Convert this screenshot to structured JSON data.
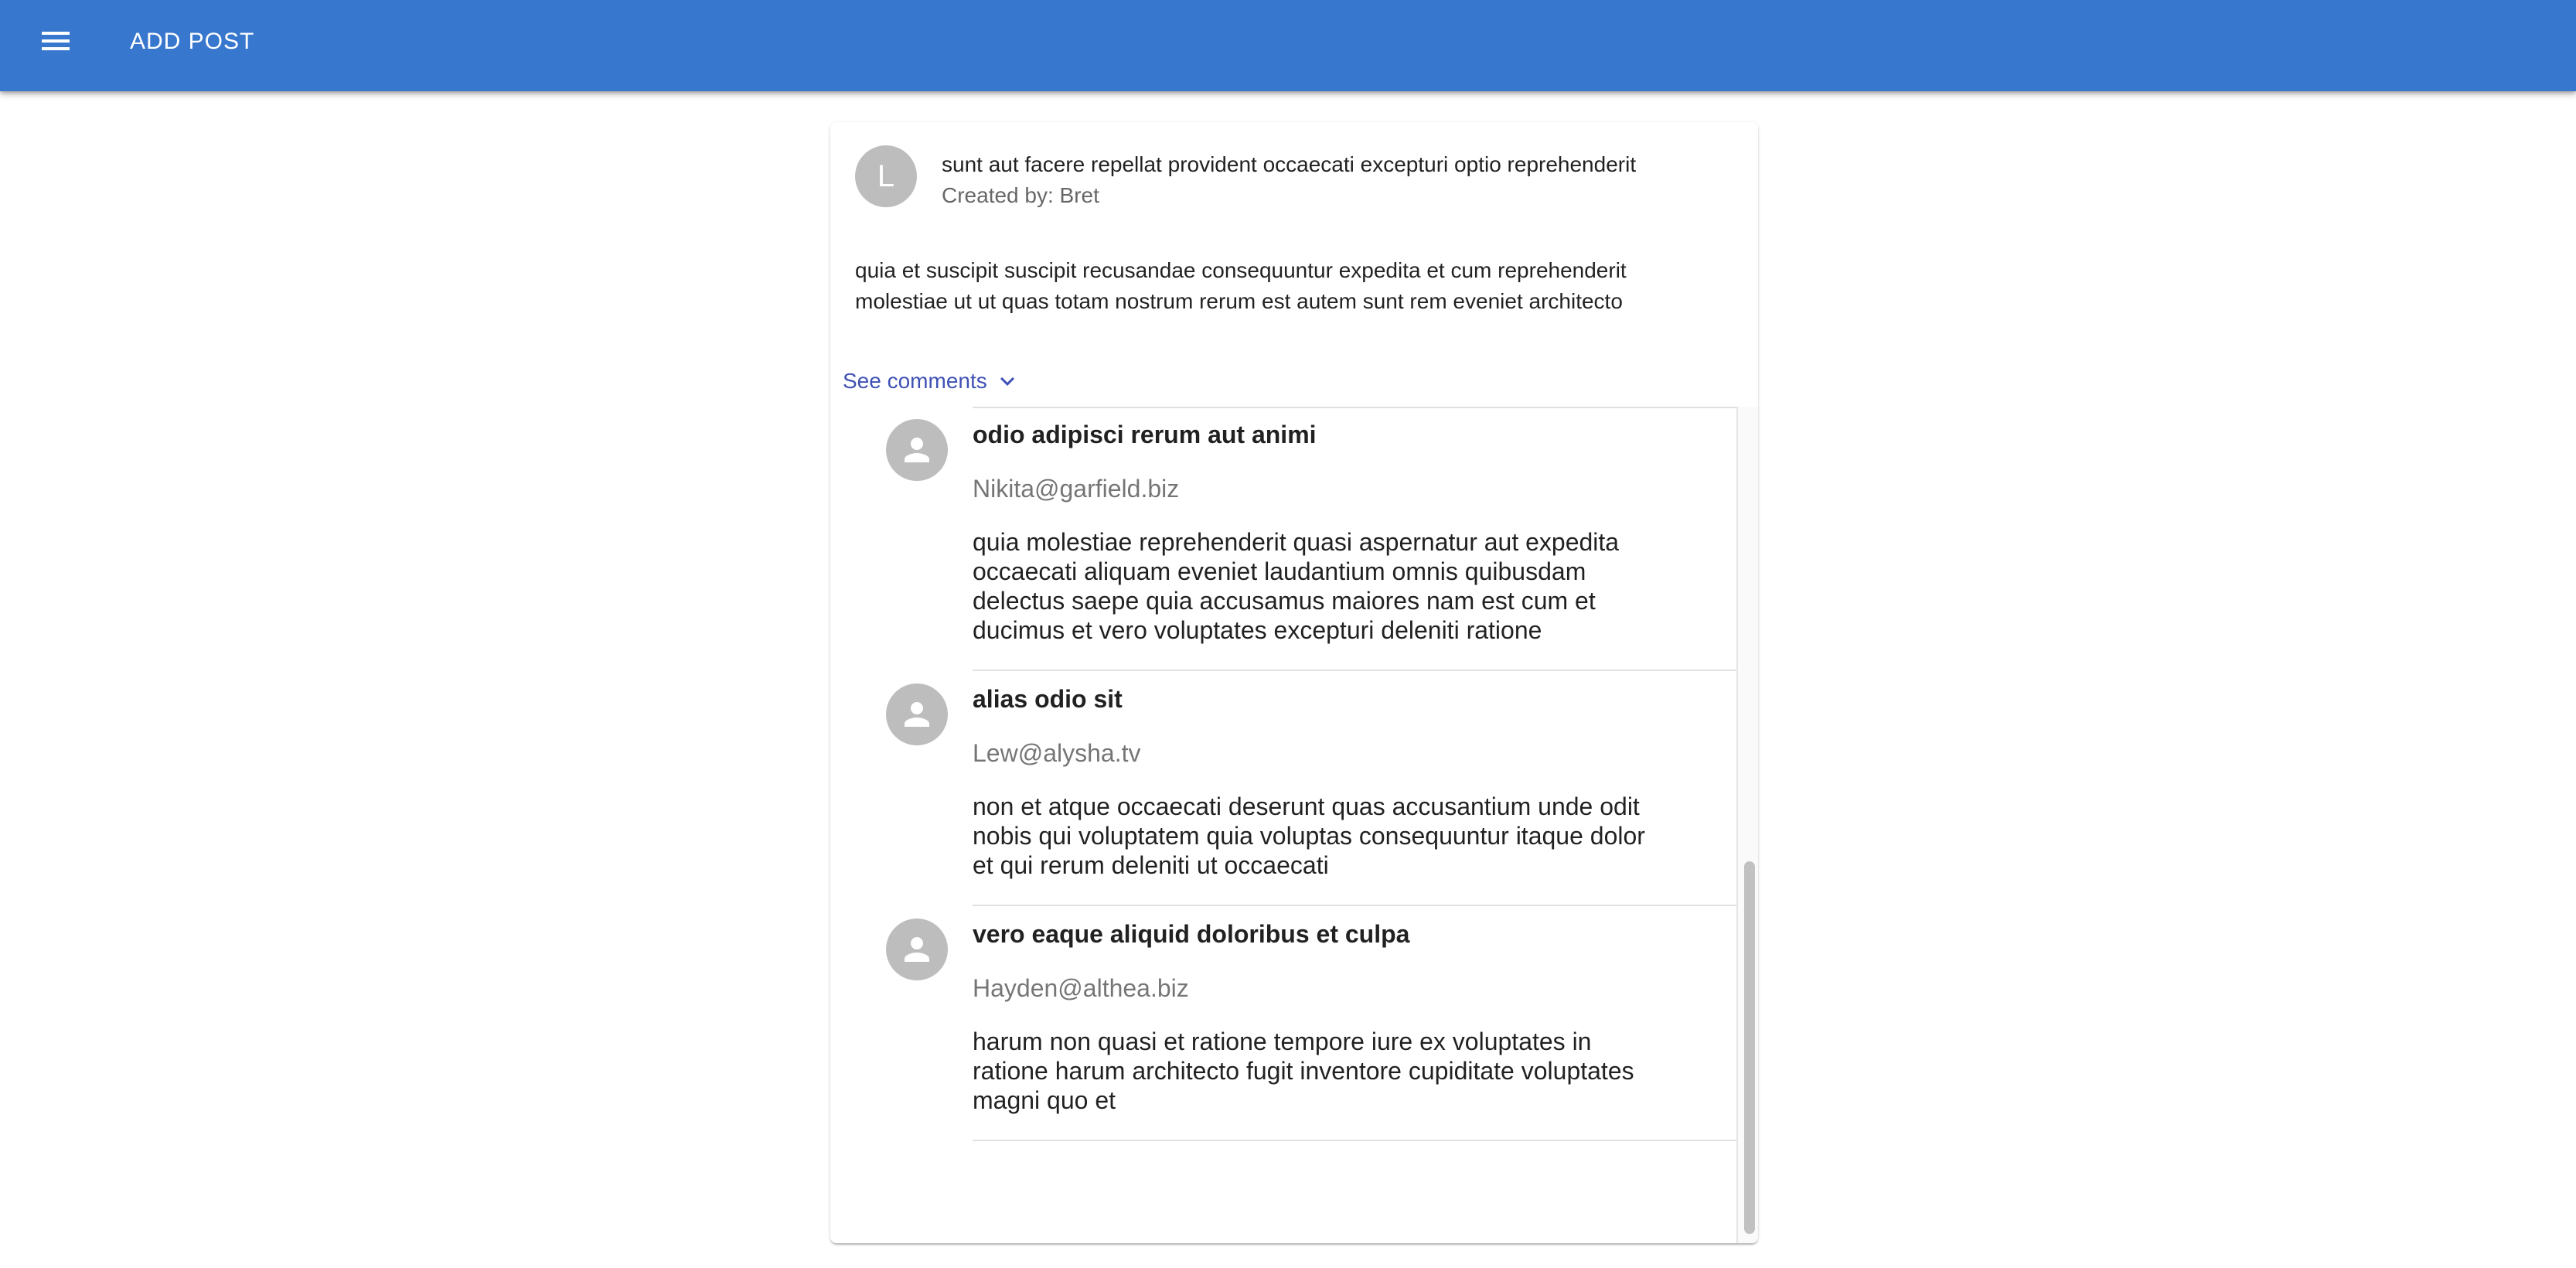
{
  "app_bar": {
    "title": "ADD POST",
    "color": "#3777cd",
    "menu_icon": "menu-icon"
  },
  "post": {
    "avatar_letter": "L",
    "title": "sunt aut facere repellat provident occaecati excepturi optio reprehenderit",
    "created_by": "Created by: Bret",
    "body_lines": [
      "quia et suscipit suscipit recusandae consequuntur expedita et cum reprehenderit",
      "molestiae ut ut quas totam nostrum rerum est autem sunt rem eveniet architecto"
    ],
    "see_comments_label": "See comments",
    "see_comments_icon": "chevron-down-icon",
    "link_color": "#3f51b5"
  },
  "comments": [
    {
      "name": "odio adipisci rerum aut animi",
      "email": "Nikita@garfield.biz",
      "body_lines": [
        "quia molestiae reprehenderit quasi aspernatur aut expedita",
        "occaecati aliquam eveniet laudantium omnis quibusdam",
        "delectus saepe quia accusamus maiores nam est cum et",
        "ducimus et vero voluptates excepturi deleniti ratione"
      ],
      "avatar_icon": "person-icon"
    },
    {
      "name": "alias odio sit",
      "email": "Lew@alysha.tv",
      "body_lines": [
        "non et atque occaecati deserunt quas accusantium unde odit",
        "nobis qui voluptatem quia voluptas consequuntur itaque dolor",
        "et qui rerum deleniti ut occaecati"
      ],
      "avatar_icon": "person-icon"
    },
    {
      "name": "vero eaque aliquid doloribus et culpa",
      "email": "Hayden@althea.biz",
      "body_lines": [
        "harum non quasi et ratione tempore iure ex voluptates in",
        "ratione harum architecto fugit inventore cupiditate voluptates",
        "magni quo et"
      ],
      "avatar_icon": "person-icon"
    }
  ]
}
